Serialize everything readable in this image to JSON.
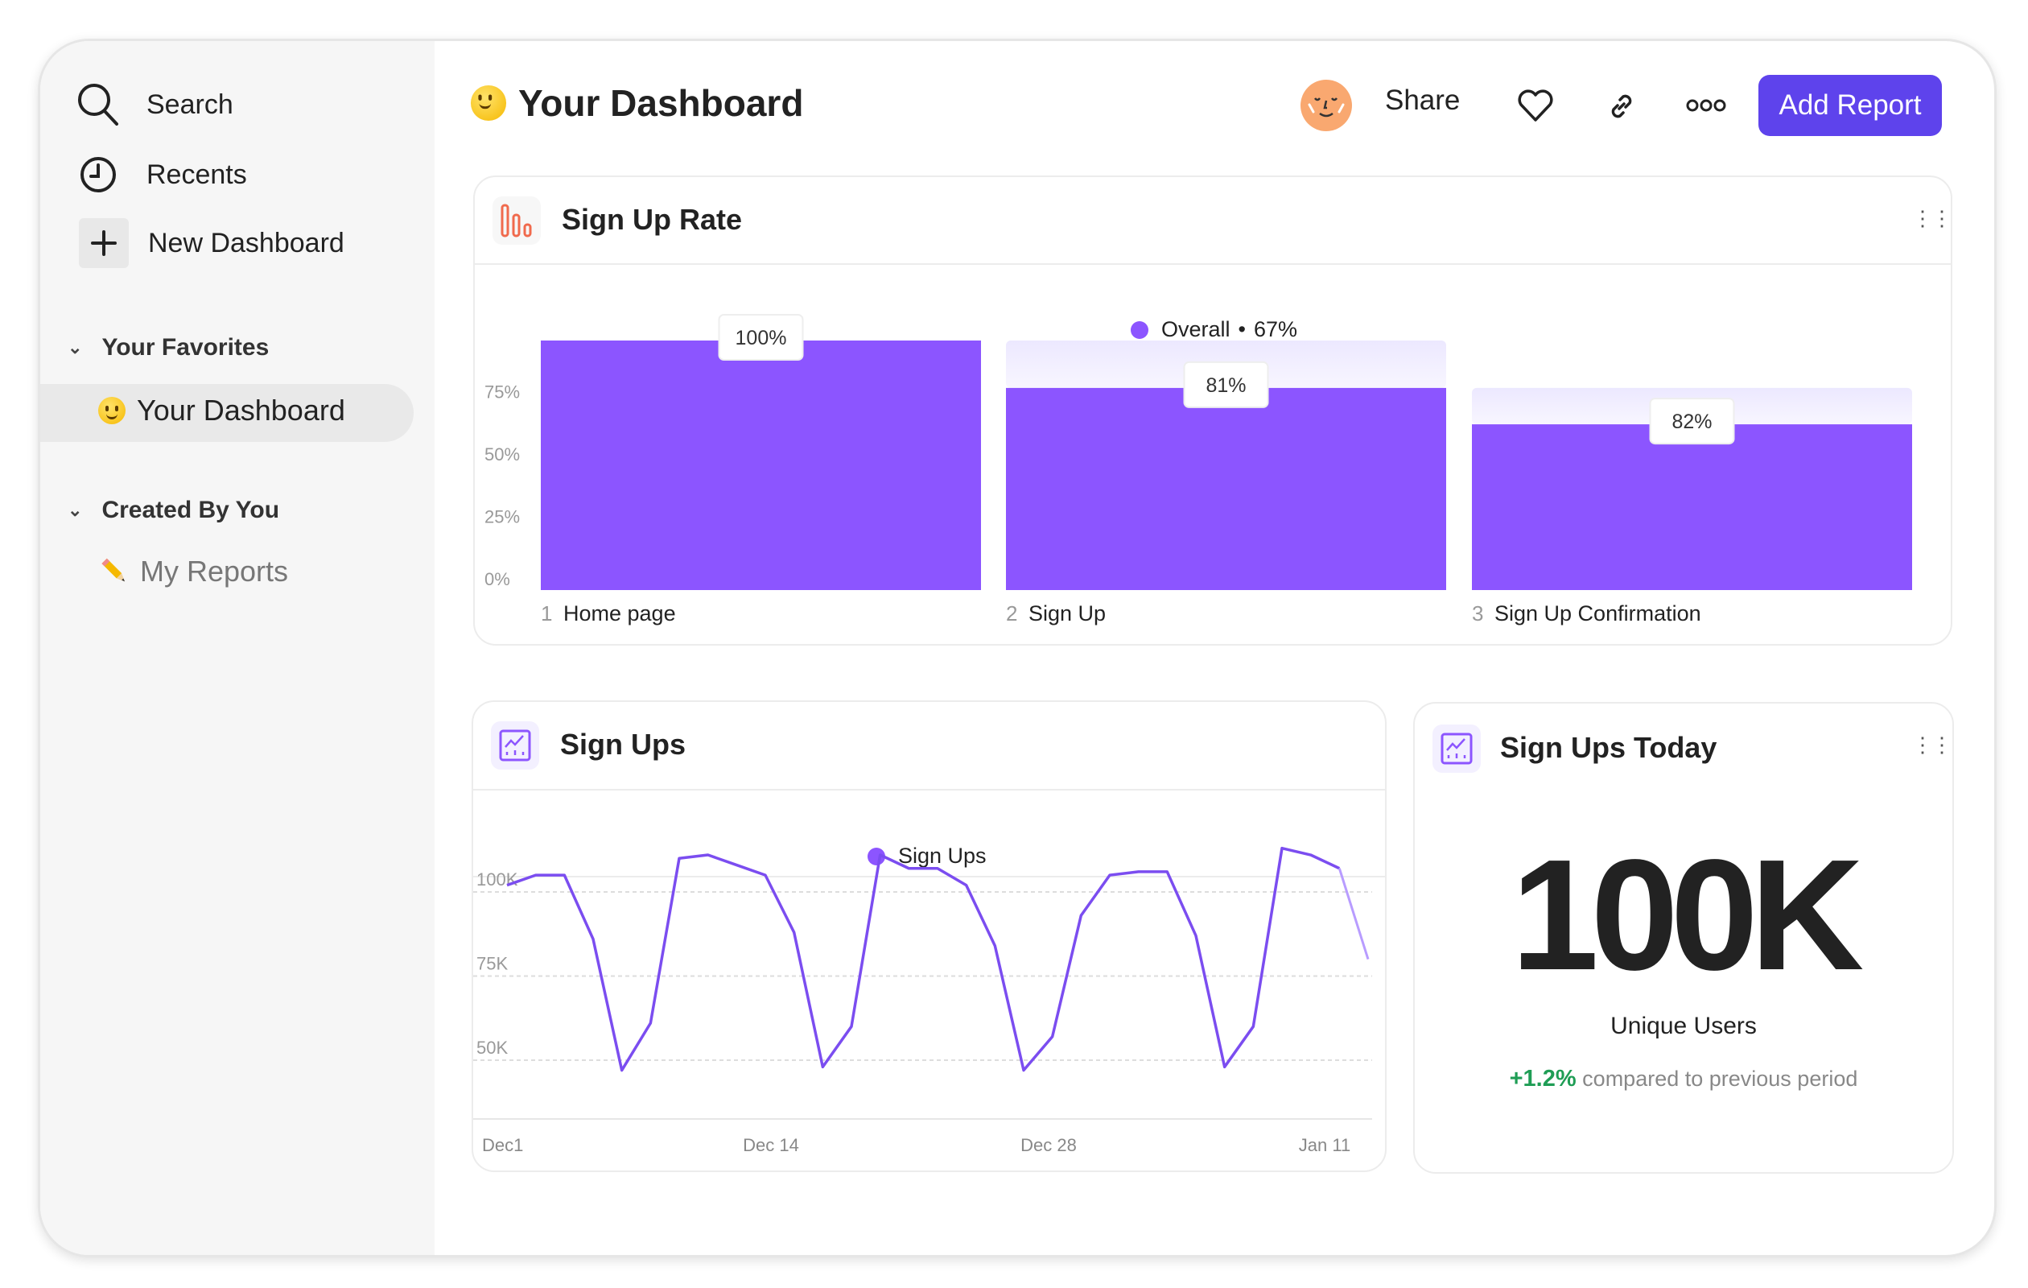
{
  "sidebar": {
    "search": "Search",
    "recents": "Recents",
    "new_dashboard": "New Dashboard",
    "favorites_header": "Your Favorites",
    "favorites": [
      {
        "label": "Your Dashboard",
        "icon": "smiley-emoji-icon",
        "active": true
      }
    ],
    "created_header": "Created By You",
    "created": [
      {
        "label": "My Reports",
        "icon": "pencil-emoji-icon"
      }
    ]
  },
  "header": {
    "title": "Your Dashboard",
    "share": "Share",
    "add_report": "Add Report",
    "accent": "#5e43ec"
  },
  "signup_rate": {
    "title": "Sign Up Rate",
    "legend_label": "Overall",
    "legend_sep": "•",
    "legend_value": "67%",
    "chart_data": {
      "type": "bar",
      "subtype": "funnel",
      "categories": [
        "Home page",
        "Sign Up",
        "Sign Up Confirmation"
      ],
      "step_numbers": [
        "1",
        "2",
        "3"
      ],
      "step_conversion_labels": [
        "100%",
        "81%",
        "82%"
      ],
      "step_conversion": [
        100,
        81,
        82
      ],
      "yticks": [
        "0%",
        "25%",
        "50%",
        "75%"
      ],
      "ylim": [
        0,
        100
      ],
      "color": "#8c55ff",
      "dropoff_color": "#e8e2ff"
    }
  },
  "signups": {
    "title": "Sign Ups",
    "chart_data": {
      "type": "line",
      "series": [
        {
          "name": "Sign Ups",
          "values": [
            102,
            105,
            105,
            86,
            47,
            61,
            110,
            111,
            108,
            105,
            88,
            48,
            60,
            111,
            107,
            107,
            102,
            84,
            47,
            57,
            93,
            105,
            106,
            106,
            87,
            48,
            60,
            113,
            111,
            107,
            80
          ]
        }
      ],
      "unit": "K",
      "yticks": [
        "100K",
        "75K",
        "50K"
      ],
      "ytick_values": [
        100,
        75,
        50
      ],
      "xticks": [
        "Dec1",
        "Dec 14",
        "Dec 28",
        "Jan 11"
      ],
      "grid": true,
      "legend": "top-center",
      "color": "#7b4df0"
    }
  },
  "signups_today": {
    "title": "Sign Ups Today",
    "value": "100K",
    "label": "Unique Users",
    "change": "+1.2%",
    "change_text": "compared to previous period",
    "change_color": "#1f9d55"
  }
}
